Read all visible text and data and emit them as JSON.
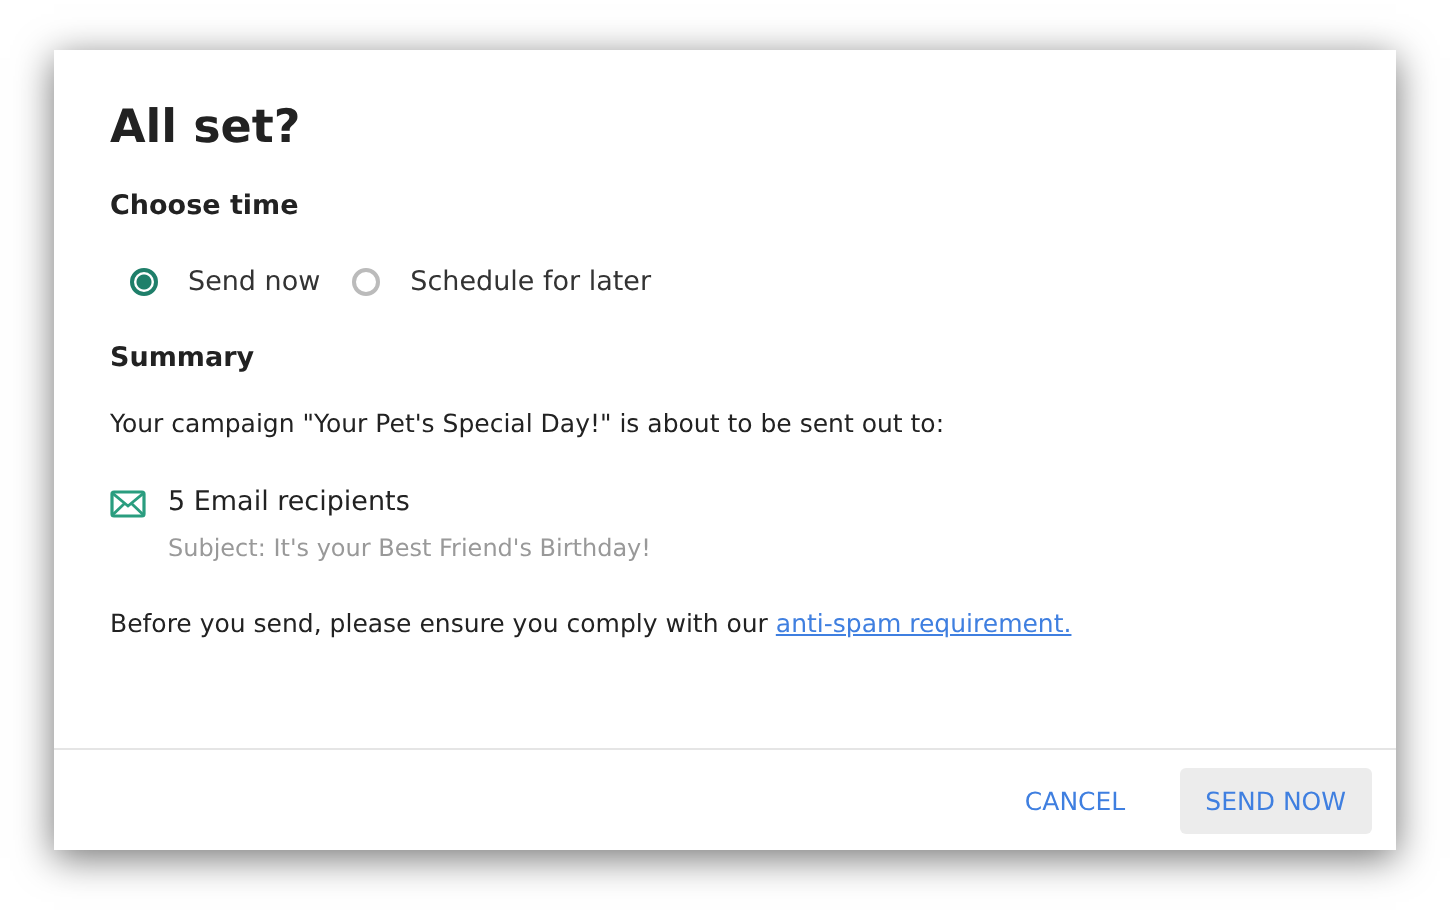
{
  "dialog": {
    "title": "All set?"
  },
  "choose_time": {
    "heading": "Choose time",
    "options": [
      {
        "label": "Send now",
        "selected": true
      },
      {
        "label": "Schedule for later",
        "selected": false
      }
    ]
  },
  "summary": {
    "heading": "Summary",
    "text": "Your campaign \"Your Pet's Special Day!\" is about to be sent out to:",
    "recipients": "5 Email recipients",
    "subject": "Subject: It's your Best Friend's Birthday!"
  },
  "notice": {
    "text": "Before you send, please ensure you comply with our",
    "link": "anti-spam requirement."
  },
  "buttons": [
    {
      "label": "CANCEL",
      "kind": "text"
    },
    {
      "label": "SEND NOW",
      "kind": "filled"
    }
  ]
}
